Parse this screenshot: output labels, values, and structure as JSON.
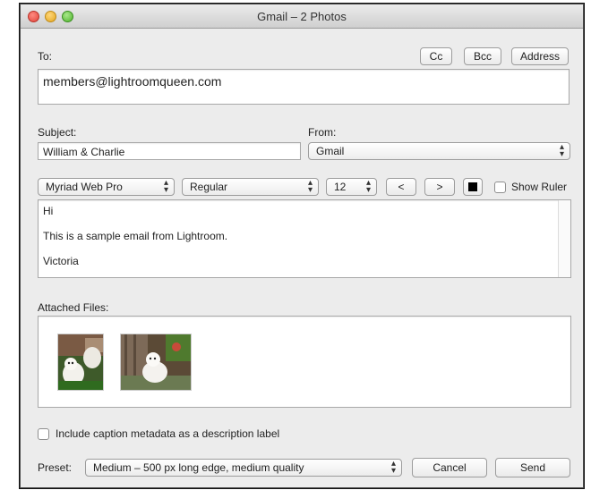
{
  "window": {
    "title": "Gmail – 2 Photos"
  },
  "to": {
    "label": "To:",
    "value": "members@lightroomqueen.com"
  },
  "header_buttons": {
    "cc": "Cc",
    "bcc": "Bcc",
    "address": "Address"
  },
  "subject": {
    "label": "Subject:",
    "value": "William & Charlie"
  },
  "from": {
    "label": "From:",
    "value": "Gmail"
  },
  "format_bar": {
    "font": "Myriad Web Pro",
    "style": "Regular",
    "size": "12",
    "decrease": "<",
    "increase": ">",
    "show_ruler": "Show Ruler"
  },
  "message": {
    "lines": [
      "Hi",
      "This is a sample email from Lightroom.",
      "Victoria"
    ]
  },
  "attachments": {
    "label": "Attached Files:",
    "items": [
      "photo-1",
      "photo-2"
    ]
  },
  "include_caption": "Include caption metadata as a description label",
  "preset": {
    "label": "Preset:",
    "value": "Medium – 500 px long edge, medium quality"
  },
  "footer_buttons": {
    "cancel": "Cancel",
    "send": "Send"
  },
  "colors": {
    "window_bg": "#ececec",
    "close": "#e0443a",
    "minimize": "#e3a51f",
    "zoom": "#4fb32d"
  }
}
